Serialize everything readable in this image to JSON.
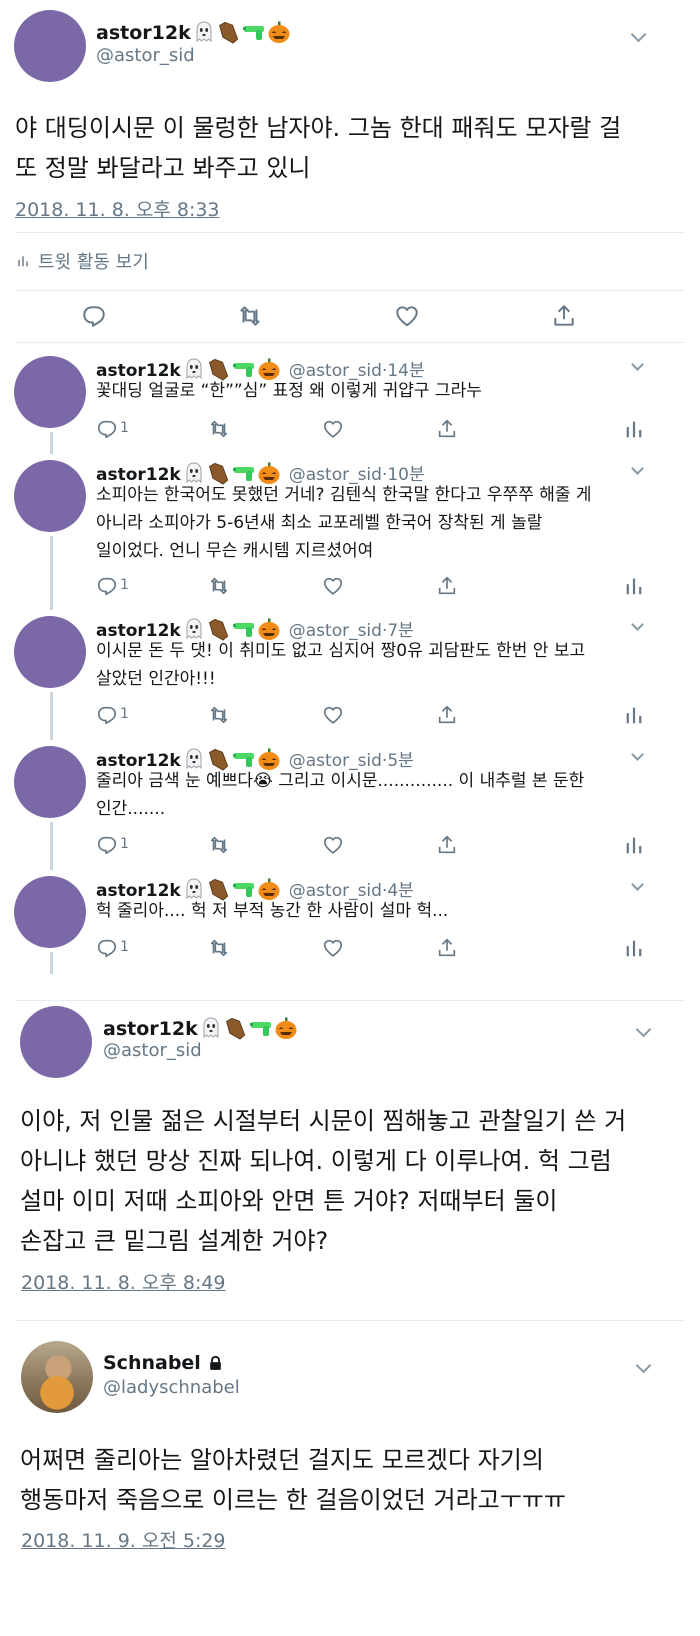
{
  "tweet1": {
    "name": "astor12k",
    "handle": "@astor_sid",
    "lines": [
      "야 대딩이시문 이 물렁한 남자야. 그놈 한대 패줘도 모자랄 걸",
      "또 정말 봐달라고 봐주고 있니"
    ],
    "date": "2018. 11. 8. 오후 8:33",
    "activity": "트윗 활동 보기"
  },
  "emoji_icons": [
    "ghost-icon",
    "coffin-icon",
    "water-gun-icon",
    "jack-o-lantern-icon"
  ],
  "replies": [
    {
      "name": "astor12k",
      "handle": "@astor_sid",
      "time": "14분",
      "lines": [
        "꽃대딩 얼굴로 “한””심” 표정 왜 이렇게 귀얍구 그라누"
      ],
      "reply_count": "1"
    },
    {
      "name": "astor12k",
      "handle": "@astor_sid",
      "time": "10분",
      "lines": [
        "소피아는 한국어도 못했던 거네? 김텐식 한국말 한다고 우쭈쭈 해줄 게",
        "아니라 소피아가 5-6년새 최소 교포레벨 한국어 장착된 게 놀랄",
        "일이었다. 언니 무슨 캐시템 지르셨어여"
      ],
      "reply_count": "1"
    },
    {
      "name": "astor12k",
      "handle": "@astor_sid",
      "time": "7분",
      "lines": [
        "이시문 돈 두 댓! 이 취미도 없고 심지어 짱0유 괴담판도 한번 안 보고",
        "살았던 인간아!!!"
      ],
      "reply_count": "1"
    },
    {
      "name": "astor12k",
      "handle": "@astor_sid",
      "time": "5분",
      "lines": [
        "줄리아 금색 눈 예쁘다😭 그리고 이시문.............. 이 내추럴 본 둔한",
        "인간......."
      ],
      "reply_count": "1"
    },
    {
      "name": "astor12k",
      "handle": "@astor_sid",
      "time": "4분",
      "lines": [
        "헉 줄리아.... 헉 저 부적 농간 한 사람이 설마 헉..."
      ],
      "reply_count": "1"
    }
  ],
  "tweet2": {
    "name": "astor12k",
    "handle": "@astor_sid",
    "lines": [
      "이야, 저 인물 젊은 시절부터 시문이 찜해놓고 관찰일기 쓴 거",
      "아니냐 했던 망상 진짜 되나여. 이렇게 다 이루나여. 헉 그럼",
      "설마 이미 저때 소피아와 안면 튼 거야? 저때부터 둘이",
      "손잡고 큰 밑그림 설계한 거야?"
    ],
    "date": "2018. 11. 8. 오후 8:49"
  },
  "tweet3": {
    "name": "Schnabel",
    "handle": "@ladyschnabel",
    "lines": [
      "어쩌면 줄리아는 알아차렸던 걸지도 모르겠다 자기의",
      "행동마저 죽음으로 이르는 한 걸음이었던 거라고ㅜㅠㅠ"
    ],
    "date": "2018. 11. 9. 오전 5:29"
  },
  "colors": {
    "avatar": "#7b68a6",
    "secondary_text": "#657786",
    "divider": "#e6ecf0",
    "thread_line": "#ccd6dd"
  }
}
